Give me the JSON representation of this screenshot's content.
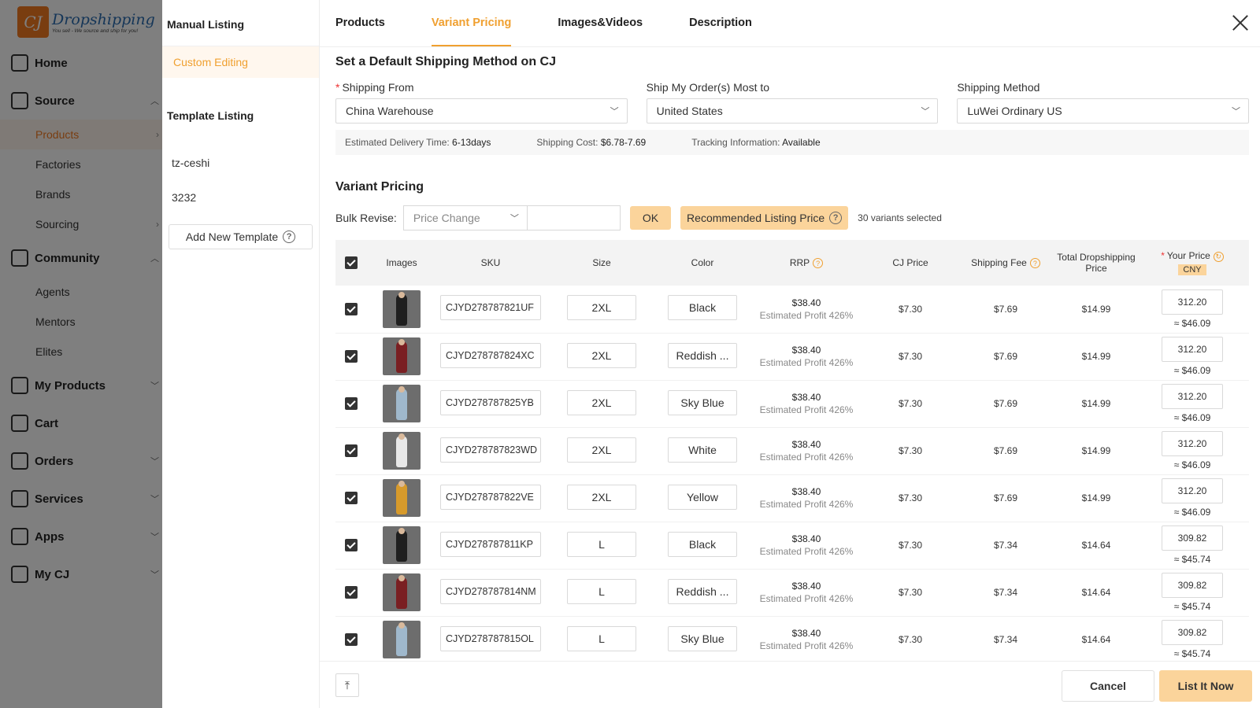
{
  "brand": {
    "name": "Dropshipping",
    "tagline": "You sell - We source and ship for you!"
  },
  "sidebar": {
    "items": [
      {
        "label": "Home",
        "icon": "home-icon"
      },
      {
        "label": "Source",
        "icon": "source-icon"
      },
      {
        "label": "Products"
      },
      {
        "label": "Factories"
      },
      {
        "label": "Brands"
      },
      {
        "label": "Sourcing"
      },
      {
        "label": "Community",
        "icon": "community-icon"
      },
      {
        "label": "Agents"
      },
      {
        "label": "Mentors"
      },
      {
        "label": "Elites"
      },
      {
        "label": "My Products",
        "icon": "my-products-icon"
      },
      {
        "label": "Cart",
        "icon": "cart-icon"
      },
      {
        "label": "Orders",
        "icon": "orders-icon"
      },
      {
        "label": "Services",
        "icon": "services-icon"
      },
      {
        "label": "Apps",
        "icon": "apps-icon"
      },
      {
        "label": "My CJ",
        "icon": "my-cj-icon"
      }
    ]
  },
  "listing": {
    "manual_title": "Manual Listing",
    "custom_editing": "Custom Editing",
    "template_title": "Template Listing",
    "templates": [
      "tz-ceshi",
      "3232"
    ],
    "add_template": "Add New Template"
  },
  "tabs": [
    "Products",
    "Variant Pricing",
    "Images&Videos",
    "Description"
  ],
  "active_tab": "Variant Pricing",
  "shipping": {
    "title": "Set a Default Shipping Method on CJ",
    "from_label": "Shipping From",
    "from_value": "China Warehouse",
    "to_label": "Ship My Order(s) Most to",
    "to_value": "United States",
    "method_label": "Shipping Method",
    "method_value": "LuWei Ordinary US",
    "delivery_label": "Estimated Delivery Time:",
    "delivery_value": "6-13days",
    "cost_label": "Shipping Cost:",
    "cost_value": "$6.78-7.69",
    "tracking_label": "Tracking Information:",
    "tracking_value": "Available"
  },
  "variant_pricing": {
    "title": "Variant Pricing",
    "bulk_label": "Bulk Revise:",
    "bulk_placeholder": "Price Change",
    "ok_label": "OK",
    "recommended_label": "Recommended Listing Price",
    "selected_text": "30 variants selected"
  },
  "table": {
    "headers": {
      "images": "Images",
      "sku": "SKU",
      "size": "Size",
      "color": "Color",
      "rrp": "RRP",
      "cj_price": "CJ Price",
      "shipping_fee": "Shipping Fee",
      "total": "Total Dropshipping Price",
      "your_price": "Your Price",
      "currency": "CNY"
    },
    "rows": [
      {
        "sku": "CJYD278787821UF",
        "size": "2XL",
        "color": "Black",
        "swatch": "#1f1f1f",
        "rrp": "$38.40",
        "profit": "Estimated Profit 426%",
        "cj_price": "$7.30",
        "shipping_fee": "$7.69",
        "total": "$14.99",
        "your_price": "312.20",
        "your_price_usd": "≈ $46.09"
      },
      {
        "sku": "CJYD278787824XC",
        "size": "2XL",
        "color": "Reddish ...",
        "swatch": "#7a1f22",
        "rrp": "$38.40",
        "profit": "Estimated Profit 426%",
        "cj_price": "$7.30",
        "shipping_fee": "$7.69",
        "total": "$14.99",
        "your_price": "312.20",
        "your_price_usd": "≈ $46.09"
      },
      {
        "sku": "CJYD278787825YB",
        "size": "2XL",
        "color": "Sky Blue",
        "swatch": "#9fb8cc",
        "rrp": "$38.40",
        "profit": "Estimated Profit 426%",
        "cj_price": "$7.30",
        "shipping_fee": "$7.69",
        "total": "$14.99",
        "your_price": "312.20",
        "your_price_usd": "≈ $46.09"
      },
      {
        "sku": "CJYD278787823WD",
        "size": "2XL",
        "color": "White",
        "swatch": "#e8e8e8",
        "rrp": "$38.40",
        "profit": "Estimated Profit 426%",
        "cj_price": "$7.30",
        "shipping_fee": "$7.69",
        "total": "$14.99",
        "your_price": "312.20",
        "your_price_usd": "≈ $46.09"
      },
      {
        "sku": "CJYD278787822VE",
        "size": "2XL",
        "color": "Yellow",
        "swatch": "#d79a2b",
        "rrp": "$38.40",
        "profit": "Estimated Profit 426%",
        "cj_price": "$7.30",
        "shipping_fee": "$7.69",
        "total": "$14.99",
        "your_price": "312.20",
        "your_price_usd": "≈ $46.09"
      },
      {
        "sku": "CJYD278787811KP",
        "size": "L",
        "color": "Black",
        "swatch": "#1f1f1f",
        "rrp": "$38.40",
        "profit": "Estimated Profit 426%",
        "cj_price": "$7.30",
        "shipping_fee": "$7.34",
        "total": "$14.64",
        "your_price": "309.82",
        "your_price_usd": "≈ $45.74"
      },
      {
        "sku": "CJYD278787814NM",
        "size": "L",
        "color": "Reddish ...",
        "swatch": "#7a1f22",
        "rrp": "$38.40",
        "profit": "Estimated Profit 426%",
        "cj_price": "$7.30",
        "shipping_fee": "$7.34",
        "total": "$14.64",
        "your_price": "309.82",
        "your_price_usd": "≈ $45.74"
      },
      {
        "sku": "CJYD278787815OL",
        "size": "L",
        "color": "Sky Blue",
        "swatch": "#9fb8cc",
        "rrp": "$38.40",
        "profit": "Estimated Profit 426%",
        "cj_price": "$7.30",
        "shipping_fee": "$7.34",
        "total": "$14.64",
        "your_price": "309.82",
        "your_price_usd": "≈ $45.74"
      }
    ]
  },
  "footer": {
    "cancel_label": "Cancel",
    "list_label": "List It Now"
  },
  "colors": {
    "accent": "#f0a030",
    "button_fill": "#fbd49b",
    "brand_orange": "#f37a21"
  }
}
